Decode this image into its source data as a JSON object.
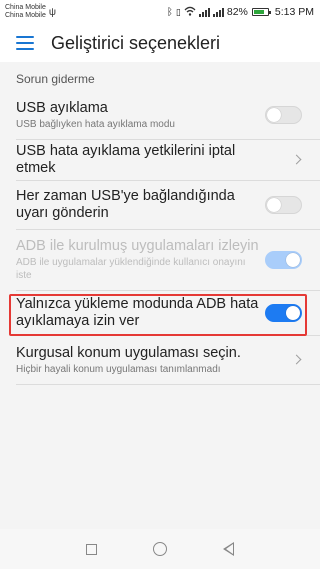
{
  "status_bar": {
    "carrier1": "China Mobile",
    "carrier2": "China Mobile",
    "battery_percent": "82%",
    "time": "5:13 PM",
    "battery_level": 0.82
  },
  "app_bar": {
    "title": "Geliştirici seçenekleri"
  },
  "section": {
    "header": "Sorun giderme"
  },
  "items": [
    {
      "title": "USB ayıklama",
      "subtitle": "USB bağlıyken hata ayıklama  modu",
      "control": "toggle",
      "state": "off"
    },
    {
      "title": "USB hata ayıklama yetkilerini iptal etmek",
      "control": "chevron"
    },
    {
      "title": "Her zaman USB'ye bağlandığında uyarı gönderin",
      "control": "toggle",
      "state": "off"
    },
    {
      "title": "ADB ile kurulmuş uygulamaları izleyin",
      "subtitle": "ADB ile uygulamalar yüklendiğinde kullanıcı onayını iste",
      "control": "toggle",
      "state": "on-disabled"
    },
    {
      "title": "Yalnızca yükleme modunda ADB hata ayıklamaya izin ver",
      "control": "toggle",
      "state": "on",
      "highlighted": true
    },
    {
      "title": "Kurgusal konum uygulaması seçin.",
      "subtitle": "Hiçbir hayali konum uygulaması tanımlanmadı",
      "control": "chevron"
    }
  ],
  "colors": {
    "accent": "#1d7bf2",
    "highlight_border": "#e53935",
    "battery_fill": "#2da53b"
  }
}
